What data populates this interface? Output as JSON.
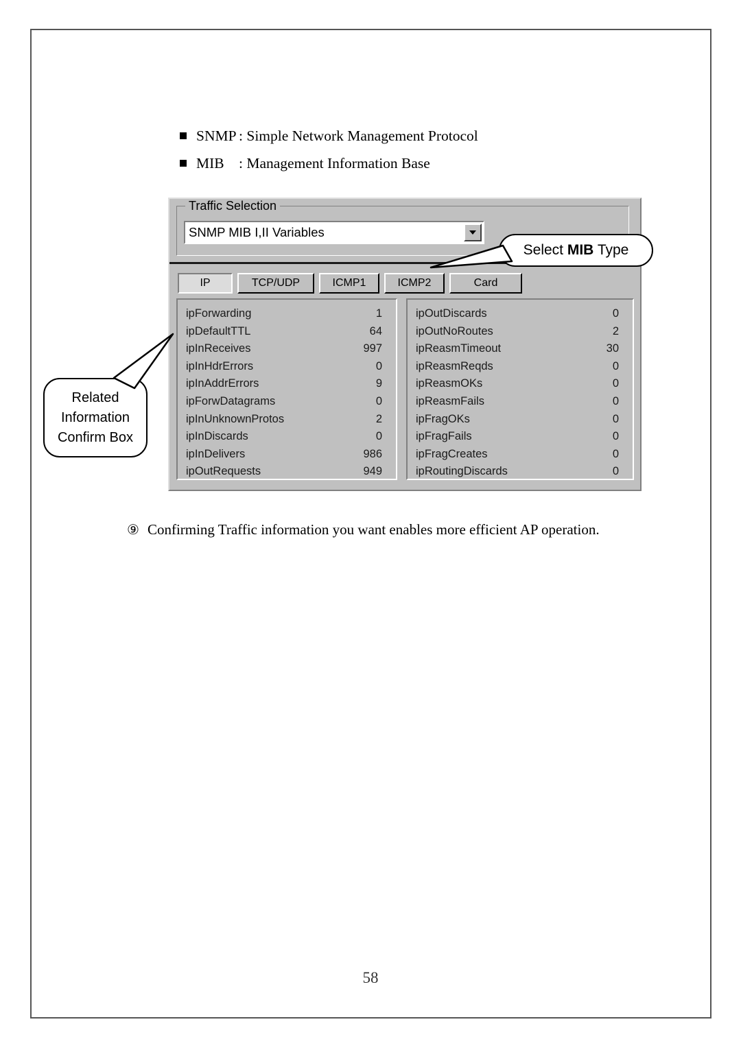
{
  "page": {
    "number": "58"
  },
  "bullets": [
    {
      "icon": "filled-square-bullet",
      "term": "SNMP",
      "separator": ": ",
      "definition": "Simple Network Management Protocol"
    },
    {
      "icon": "filled-square-bullet",
      "term": "MIB",
      "separator": ": ",
      "definition": "Management Information Base"
    }
  ],
  "dialog": {
    "group": {
      "legend": "Traffic Selection",
      "combo": {
        "value": "SNMP MIB I,II Variables",
        "arrow_icon": "chevron-down-icon"
      }
    },
    "tabs": [
      {
        "label": "IP",
        "selected": true
      },
      {
        "label": "TCP/UDP",
        "selected": false
      },
      {
        "label": "ICMP1",
        "selected": false
      },
      {
        "label": "ICMP2",
        "selected": false
      },
      {
        "label": "Card",
        "selected": false
      }
    ],
    "left_column": [
      {
        "name": "ipForwarding",
        "value": "1"
      },
      {
        "name": "ipDefaultTTL",
        "value": "64"
      },
      {
        "name": "ipInReceives",
        "value": "997"
      },
      {
        "name": "ipInHdrErrors",
        "value": "0"
      },
      {
        "name": "ipInAddrErrors",
        "value": "9"
      },
      {
        "name": "ipForwDatagrams",
        "value": "0"
      },
      {
        "name": "ipInUnknownProtos",
        "value": "2"
      },
      {
        "name": "ipInDiscards",
        "value": "0"
      },
      {
        "name": "ipInDelivers",
        "value": "986"
      },
      {
        "name": "ipOutRequests",
        "value": "949"
      }
    ],
    "right_column": [
      {
        "name": "ipOutDiscards",
        "value": "0"
      },
      {
        "name": "ipOutNoRoutes",
        "value": "2"
      },
      {
        "name": "ipReasmTimeout",
        "value": "30"
      },
      {
        "name": "ipReasmReqds",
        "value": "0"
      },
      {
        "name": "ipReasmOKs",
        "value": "0"
      },
      {
        "name": "ipReasmFails",
        "value": "0"
      },
      {
        "name": "ipFragOKs",
        "value": "0"
      },
      {
        "name": "ipFragFails",
        "value": "0"
      },
      {
        "name": "ipFragCreates",
        "value": "0"
      },
      {
        "name": "ipRoutingDiscards",
        "value": "0"
      }
    ]
  },
  "callouts": {
    "mib_type": {
      "prefix": "Select ",
      "emphasis": "MIB",
      "suffix": " Type"
    },
    "related_info": {
      "line1": "Related",
      "line2": "Information",
      "line3": "Confirm Box"
    }
  },
  "footer": {
    "marker": "⑨",
    "text": "Confirming Traffic information you want enables more efficient AP operation."
  },
  "colors": {
    "dialog_face": "#c0c0c0",
    "dialog_shadow": "#808080",
    "dialog_highlight": "#ffffff",
    "field_background": "#ffffff",
    "text": "#000000",
    "page_border": "#555555"
  }
}
